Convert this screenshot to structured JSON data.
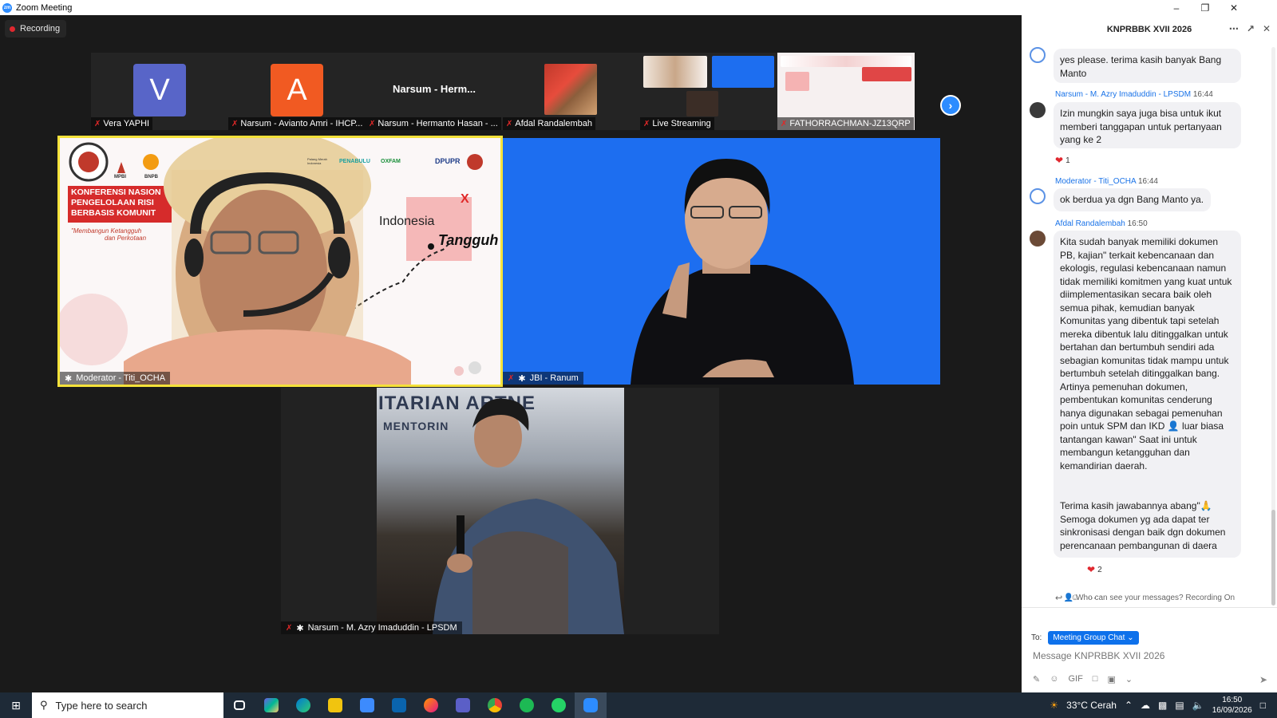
{
  "window": {
    "app_icon": "zm",
    "title": "Zoom Meeting"
  },
  "recording_label": "Recording",
  "thumbnails": [
    {
      "name": "Vera YAPHI",
      "avatar_letter": "V",
      "avatar_color": "#5865c8"
    },
    {
      "name": "Narsum - Avianto Amri - IHCP...",
      "avatar_letter": "A",
      "avatar_color": "#f15a22"
    },
    {
      "name": "Narsum - Hermanto Hasan - ...",
      "display_name": "Narsum  -  Herm..."
    },
    {
      "name": "Afdal Randalembah"
    },
    {
      "name": "Live Streaming"
    },
    {
      "name": "FATHORRACHMAN-JZ13QRP"
    }
  ],
  "tiles": {
    "moderator": {
      "name": "Moderator - Titi_OCHA"
    },
    "jbi": {
      "name": "JBI - Ranum"
    },
    "narsum": {
      "name": "Narsum - M. Azry Imaduddin - LPSDM"
    }
  },
  "slide": {
    "title_lines": [
      "KONFERENSI NASION",
      "PENGELOLAAN RISI",
      "BERBASIS KOMUNIT"
    ],
    "subtitle_line1": "\"Membangun Ketangguh",
    "subtitle_line2": "dan Perkotaan",
    "indonesia": "Indonesia",
    "tangguh": "Tangguh",
    "logo_text1": "MPBI",
    "logo_text2": "BNPB",
    "logo_text3": "PENABULU",
    "logo_text4": "OXFAM",
    "logo_text5": "DPUPR",
    "pmi_text": "Palang Merah Indonesia"
  },
  "banner": {
    "line1": "ITARIAN  ARTNE",
    "line2": "MENTORIN"
  },
  "chat": {
    "title": "KNPRBBK XVII 2026",
    "messages": [
      {
        "sender": "",
        "time": "",
        "text": "yes please. terima kasih banyak Bang Manto"
      },
      {
        "sender": "Narsum - M. Azry Imaduddin - LPSDM",
        "time": "16:44",
        "text": "Izin mungkin saya juga bisa untuk ikut memberi tanggapan untuk pertanyaan yang ke 2",
        "reaction_count": "1"
      },
      {
        "sender": "Moderator - Titi_OCHA",
        "time": "16:44",
        "text": "ok berdua ya dgn Bang Manto ya."
      },
      {
        "sender": "Afdal Randalembah",
        "time": "16:50",
        "text_p1": "Kita sudah banyak memiliki dokumen PB, kajian\" terkait kebencanaan dan ekologis, regulasi kebencanaan namun tidak memiliki komitmen yang kuat untuk diimplementasikan secara baik oleh semua pihak, kemudian banyak Komunitas yang dibentuk tapi setelah mereka dibentuk lalu ditinggalkan untuk bertahan dan bertumbuh sendiri ada sebagian komunitas tidak mampu untuk bertumbuh setelah ditinggalkan bang. Artinya pemenuhan dokumen, pembentukan komunitas cenderung hanya digunakan sebagai pemenuhan poin untuk SPM dan IKD",
        "emoji1": "👤",
        "text_p1b": " luar biasa tantangan kawan\" Saat ini untuk membangun ketangguhan dan kemandirian daerah.",
        "text_p2": "Terima kasih jawabannya abang\"",
        "emoji2": "🙏",
        "text_p2b": " Semoga dokumen yg ada dapat ter sinkronisasi dengan baik dgn dokumen perencanaan pembangunan di daera",
        "reaction_count": "2"
      }
    ],
    "who_can_see": "Who can see your messages? Recording On",
    "to_label": "To:",
    "recipient": "Meeting Group Chat",
    "input_placeholder": "Message KNPRBBK XVII 2026",
    "toolbar": {
      "gif": "GIF"
    }
  },
  "taskbar": {
    "search_placeholder": "Type here to search",
    "weather": "33°C  Cerah",
    "time": "16:50",
    "date": "16/09/2026"
  },
  "colors": {
    "accent": "#2d8cff",
    "active_speaker_border": "#f5e23a",
    "jbi_bg": "#1d6ef0"
  }
}
